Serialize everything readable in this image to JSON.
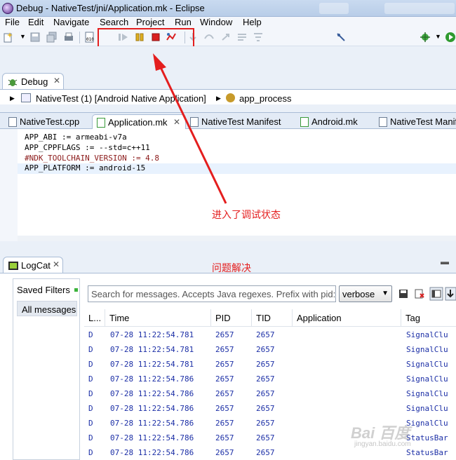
{
  "window": {
    "title": "Debug - NativeTest/jni/Application.mk - Eclipse"
  },
  "menu": [
    "File",
    "Edit",
    "Navigate",
    "Search",
    "Project",
    "Run",
    "Window",
    "Help"
  ],
  "toolbar": {
    "icons": [
      "new-icon",
      "save-icon",
      "save-all-icon",
      "print-icon",
      "binary-icon",
      "resume-icon",
      "suspend-icon",
      "terminate-icon",
      "disconnect-icon",
      "step-into-icon",
      "step-over-icon",
      "step-return-icon",
      "drop-to-frame-icon",
      "use-step-filters-icon",
      "pin-icon",
      "debug-perspective-icon",
      "run-icon"
    ]
  },
  "debug_view": {
    "tab_label": "Debug",
    "tree_row": "NativeTest (1) [Android Native Application]",
    "process_label": "app_process"
  },
  "editor": {
    "tabs": [
      "NativeTest.cpp",
      "Application.mk",
      "NativeTest Manifest",
      "Android.mk",
      "NativeTest Manife"
    ],
    "active_tab": 1,
    "lines": [
      {
        "text": "APP_ABI := armeabi-v7a",
        "style": "normal"
      },
      {
        "text": "APP_CPPFLAGS := --std=c++11",
        "style": "normal"
      },
      {
        "text": "#NDK_TOOLCHAIN_VERSION := 4.8",
        "style": "comment"
      },
      {
        "text": "APP_PLATFORM := android-15",
        "style": "current"
      }
    ]
  },
  "annotations": {
    "debug_state": "进入了调试状态",
    "problem_solved": "问题解决"
  },
  "logcat": {
    "tab_label": "LogCat",
    "saved_filters_label": "Saved Filters",
    "all_messages_label": "All messages",
    "search_placeholder": "Search for messages. Accepts Java regexes. Prefix with pid:, app:, tag: or text: to limit scope.",
    "log_level": "verbose",
    "columns": [
      "L...",
      "Time",
      "PID",
      "TID",
      "Application",
      "Tag"
    ],
    "rows": [
      {
        "level": "D",
        "time": "07-28 11:22:54.781",
        "pid": "2657",
        "tid": "2657",
        "app": "",
        "tag": "SignalClu"
      },
      {
        "level": "D",
        "time": "07-28 11:22:54.781",
        "pid": "2657",
        "tid": "2657",
        "app": "",
        "tag": "SignalClu"
      },
      {
        "level": "D",
        "time": "07-28 11:22:54.781",
        "pid": "2657",
        "tid": "2657",
        "app": "",
        "tag": "SignalClu"
      },
      {
        "level": "D",
        "time": "07-28 11:22:54.786",
        "pid": "2657",
        "tid": "2657",
        "app": "",
        "tag": "SignalClu"
      },
      {
        "level": "D",
        "time": "07-28 11:22:54.786",
        "pid": "2657",
        "tid": "2657",
        "app": "",
        "tag": "SignalClu"
      },
      {
        "level": "D",
        "time": "07-28 11:22:54.786",
        "pid": "2657",
        "tid": "2657",
        "app": "",
        "tag": "SignalClu"
      },
      {
        "level": "D",
        "time": "07-28 11:22:54.786",
        "pid": "2657",
        "tid": "2657",
        "app": "",
        "tag": "SignalClu"
      },
      {
        "level": "D",
        "time": "07-28 11:22:54.786",
        "pid": "2657",
        "tid": "2657",
        "app": "",
        "tag": "StatusBar"
      },
      {
        "level": "D",
        "time": "07-28 11:22:54.786",
        "pid": "2657",
        "tid": "2657",
        "app": "",
        "tag": "StatusBar"
      }
    ]
  },
  "watermark": {
    "main": "Bai 百度",
    "sub": "jingyan.baidu.com"
  },
  "colors": {
    "annotation_red": "#e41e1e",
    "log_debug_blue": "#1c2fa6",
    "terminate_red": "#d92020",
    "suspend_yellow": "#e0b020"
  }
}
